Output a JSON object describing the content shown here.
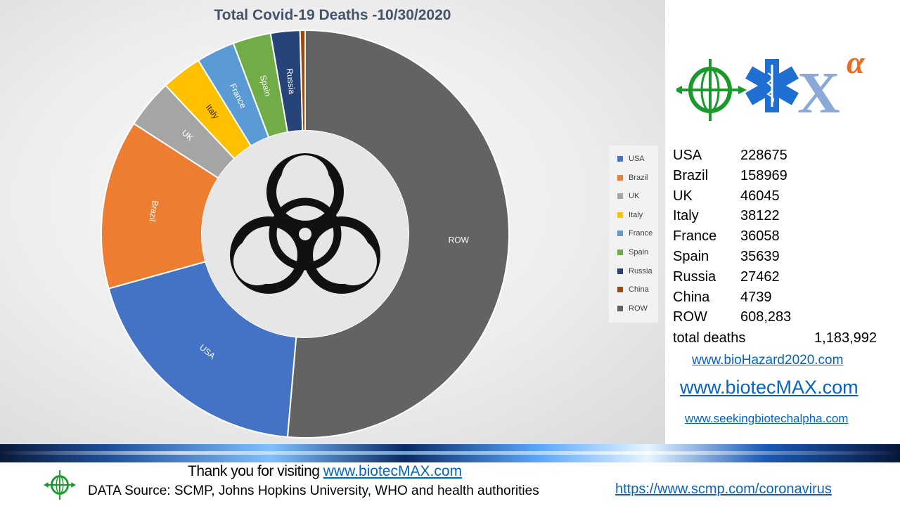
{
  "chart_data": {
    "type": "donut",
    "title": "Total Covid-19 Deaths -10/30/2020",
    "categories": [
      "USA",
      "Brazil",
      "UK",
      "Italy",
      "France",
      "Spain",
      "Russia",
      "China",
      "ROW"
    ],
    "values": [
      228675,
      158969,
      46045,
      38122,
      36058,
      35639,
      27462,
      4739,
      608283
    ],
    "colors": [
      "#4472c4",
      "#ed7d31",
      "#a5a5a5",
      "#ffc000",
      "#5b9bd5",
      "#70ad47",
      "#264478",
      "#9e480e",
      "#636363"
    ],
    "legend": "right",
    "center_symbol": "biohazard-icon"
  },
  "table": {
    "rows": [
      {
        "country": "USA",
        "deaths": "228675"
      },
      {
        "country": "Brazil",
        "deaths": "158969"
      },
      {
        "country": "UK",
        "deaths": "46045"
      },
      {
        "country": "Italy",
        "deaths": "38122"
      },
      {
        "country": "France",
        "deaths": "36058"
      },
      {
        "country": "Spain",
        "deaths": "35639"
      },
      {
        "country": "Russia",
        "deaths": "27462"
      },
      {
        "country": "China",
        "deaths": "4739"
      },
      {
        "country": "ROW",
        "deaths": "608,283"
      }
    ],
    "total_label": "total deaths",
    "total_value": "1,183,992"
  },
  "links": {
    "biohazard": "www.bioHazard2020.com",
    "biotecmax": "www.biotecMAX.com",
    "seeking": "www.seekingbiotechalpha.com",
    "scmp": "https://www.scmp.com/coronavirus"
  },
  "footer": {
    "thanks_prefix": "Thank you for visiting ",
    "thanks_link": "www.biotecMAX.com",
    "source": "DATA Source: SCMP, Johns Hopkins University, WHO and health authorities"
  },
  "logo": {
    "greek_letter": "α",
    "icons": [
      "crosshair-globe-icon",
      "star-of-life-icon",
      "x-alpha-logo"
    ]
  }
}
